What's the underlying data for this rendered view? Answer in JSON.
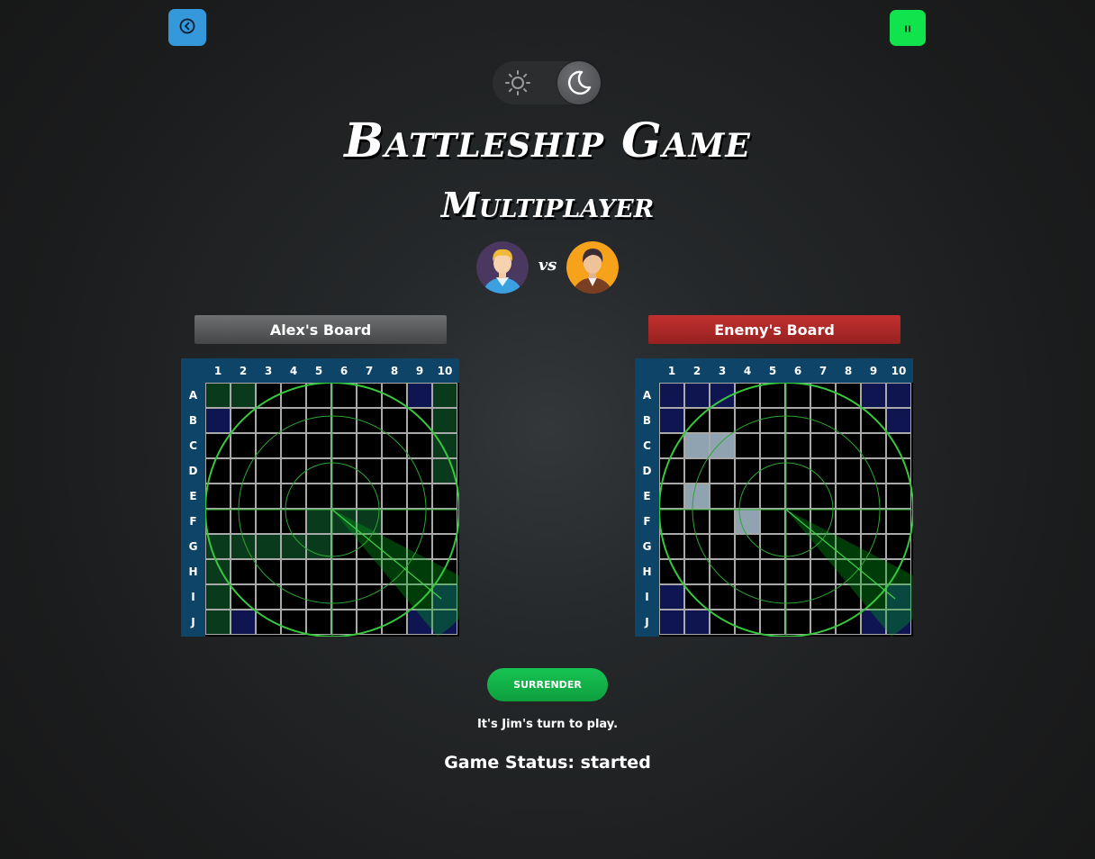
{
  "header": {
    "back_icon": "chevron-left-circle-icon",
    "pause_icon": "pause-icon",
    "theme_light_icon": "sun-icon",
    "theme_dark_icon": "moon-icon",
    "theme_selected": "dark"
  },
  "title": "Battleship Game",
  "subtitle": "Multiplayer",
  "players": {
    "vs_label": "vs",
    "player1_avatar": "avatar-blonde-man",
    "player2_avatar": "avatar-dark-hair-man"
  },
  "boards": {
    "columns": [
      "1",
      "2",
      "3",
      "4",
      "5",
      "6",
      "7",
      "8",
      "9",
      "10"
    ],
    "rows": [
      "A",
      "B",
      "C",
      "D",
      "E",
      "F",
      "G",
      "H",
      "I",
      "J"
    ],
    "player": {
      "label": "Alex's Board",
      "ship_cells": [
        "A1",
        "A2",
        "A10",
        "B10",
        "C10",
        "D10",
        "G1",
        "G2",
        "G3",
        "G4",
        "F5",
        "F6",
        "F7",
        "H1",
        "I1",
        "J1",
        "G5"
      ],
      "blue_cells": [
        "A9",
        "B1",
        "I10",
        "J2",
        "J9",
        "J10"
      ]
    },
    "enemy": {
      "label": "Enemy's Board",
      "hit_cells": [
        "C2",
        "C3",
        "E2",
        "F4"
      ],
      "blue_cells": [
        "A1",
        "A2",
        "A3",
        "A10",
        "B1",
        "B10",
        "I1",
        "I10",
        "J1",
        "J2",
        "J9",
        "J10",
        "A9"
      ]
    }
  },
  "actions": {
    "surrender_label": "SURRENDER"
  },
  "turn_text": "It's Jim's turn to play.",
  "status_text": "Game Status: started",
  "colors": {
    "back_button": "#3498db",
    "pause_button": "#11e34c",
    "board_header_bg": "#0d4467",
    "enemy_label": "#b0292a",
    "surrender": "#15b34a"
  }
}
